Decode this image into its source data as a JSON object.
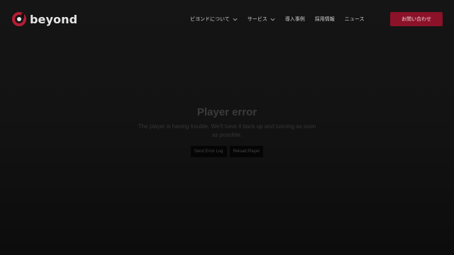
{
  "header": {
    "logo_text": "beyond",
    "nav": [
      {
        "label": "ビヨンドについて",
        "has_dropdown": true,
        "icon": "chevron-down-icon"
      },
      {
        "label": "サービス",
        "has_dropdown": true,
        "icon": "chevron-down-icon"
      },
      {
        "label": "導入事例",
        "has_dropdown": false
      },
      {
        "label": "採用情報",
        "has_dropdown": false
      },
      {
        "label": "ニュース",
        "has_dropdown": false
      }
    ],
    "contact_label": "お問い合わせ",
    "colors": {
      "accent": "#8b1228",
      "logo_ring": "#b51d35"
    }
  },
  "player_error": {
    "title": "Player error",
    "message": "The player is having trouble. We'll have it back up and running as soon as possible.",
    "send_log_label": "Send Error Log",
    "reload_label": "Reload Player"
  }
}
